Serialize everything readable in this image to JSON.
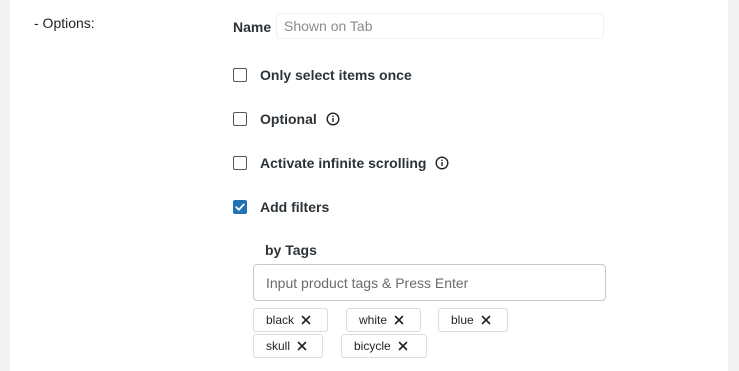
{
  "section": {
    "label": "- Options:"
  },
  "name_field": {
    "label": "Name",
    "placeholder": "Shown on Tab",
    "value": ""
  },
  "options": [
    {
      "label": "Only select items once",
      "checked": false,
      "has_info": false
    },
    {
      "label": "Optional",
      "checked": false,
      "has_info": true
    },
    {
      "label": "Activate infinite scrolling",
      "checked": false,
      "has_info": true
    },
    {
      "label": "Add filters",
      "checked": true,
      "has_info": false
    }
  ],
  "filters": {
    "heading": "by Tags",
    "input_placeholder": "Input product tags & Press Enter",
    "tags": [
      "black",
      "white",
      "blue",
      "skull",
      "bicycle"
    ]
  },
  "colors": {
    "accent": "#2271b1",
    "chip_border": "#dcdcdc"
  },
  "icons": {
    "info": "info-circle-icon",
    "remove": "close-icon",
    "check": "checkmark-icon"
  }
}
